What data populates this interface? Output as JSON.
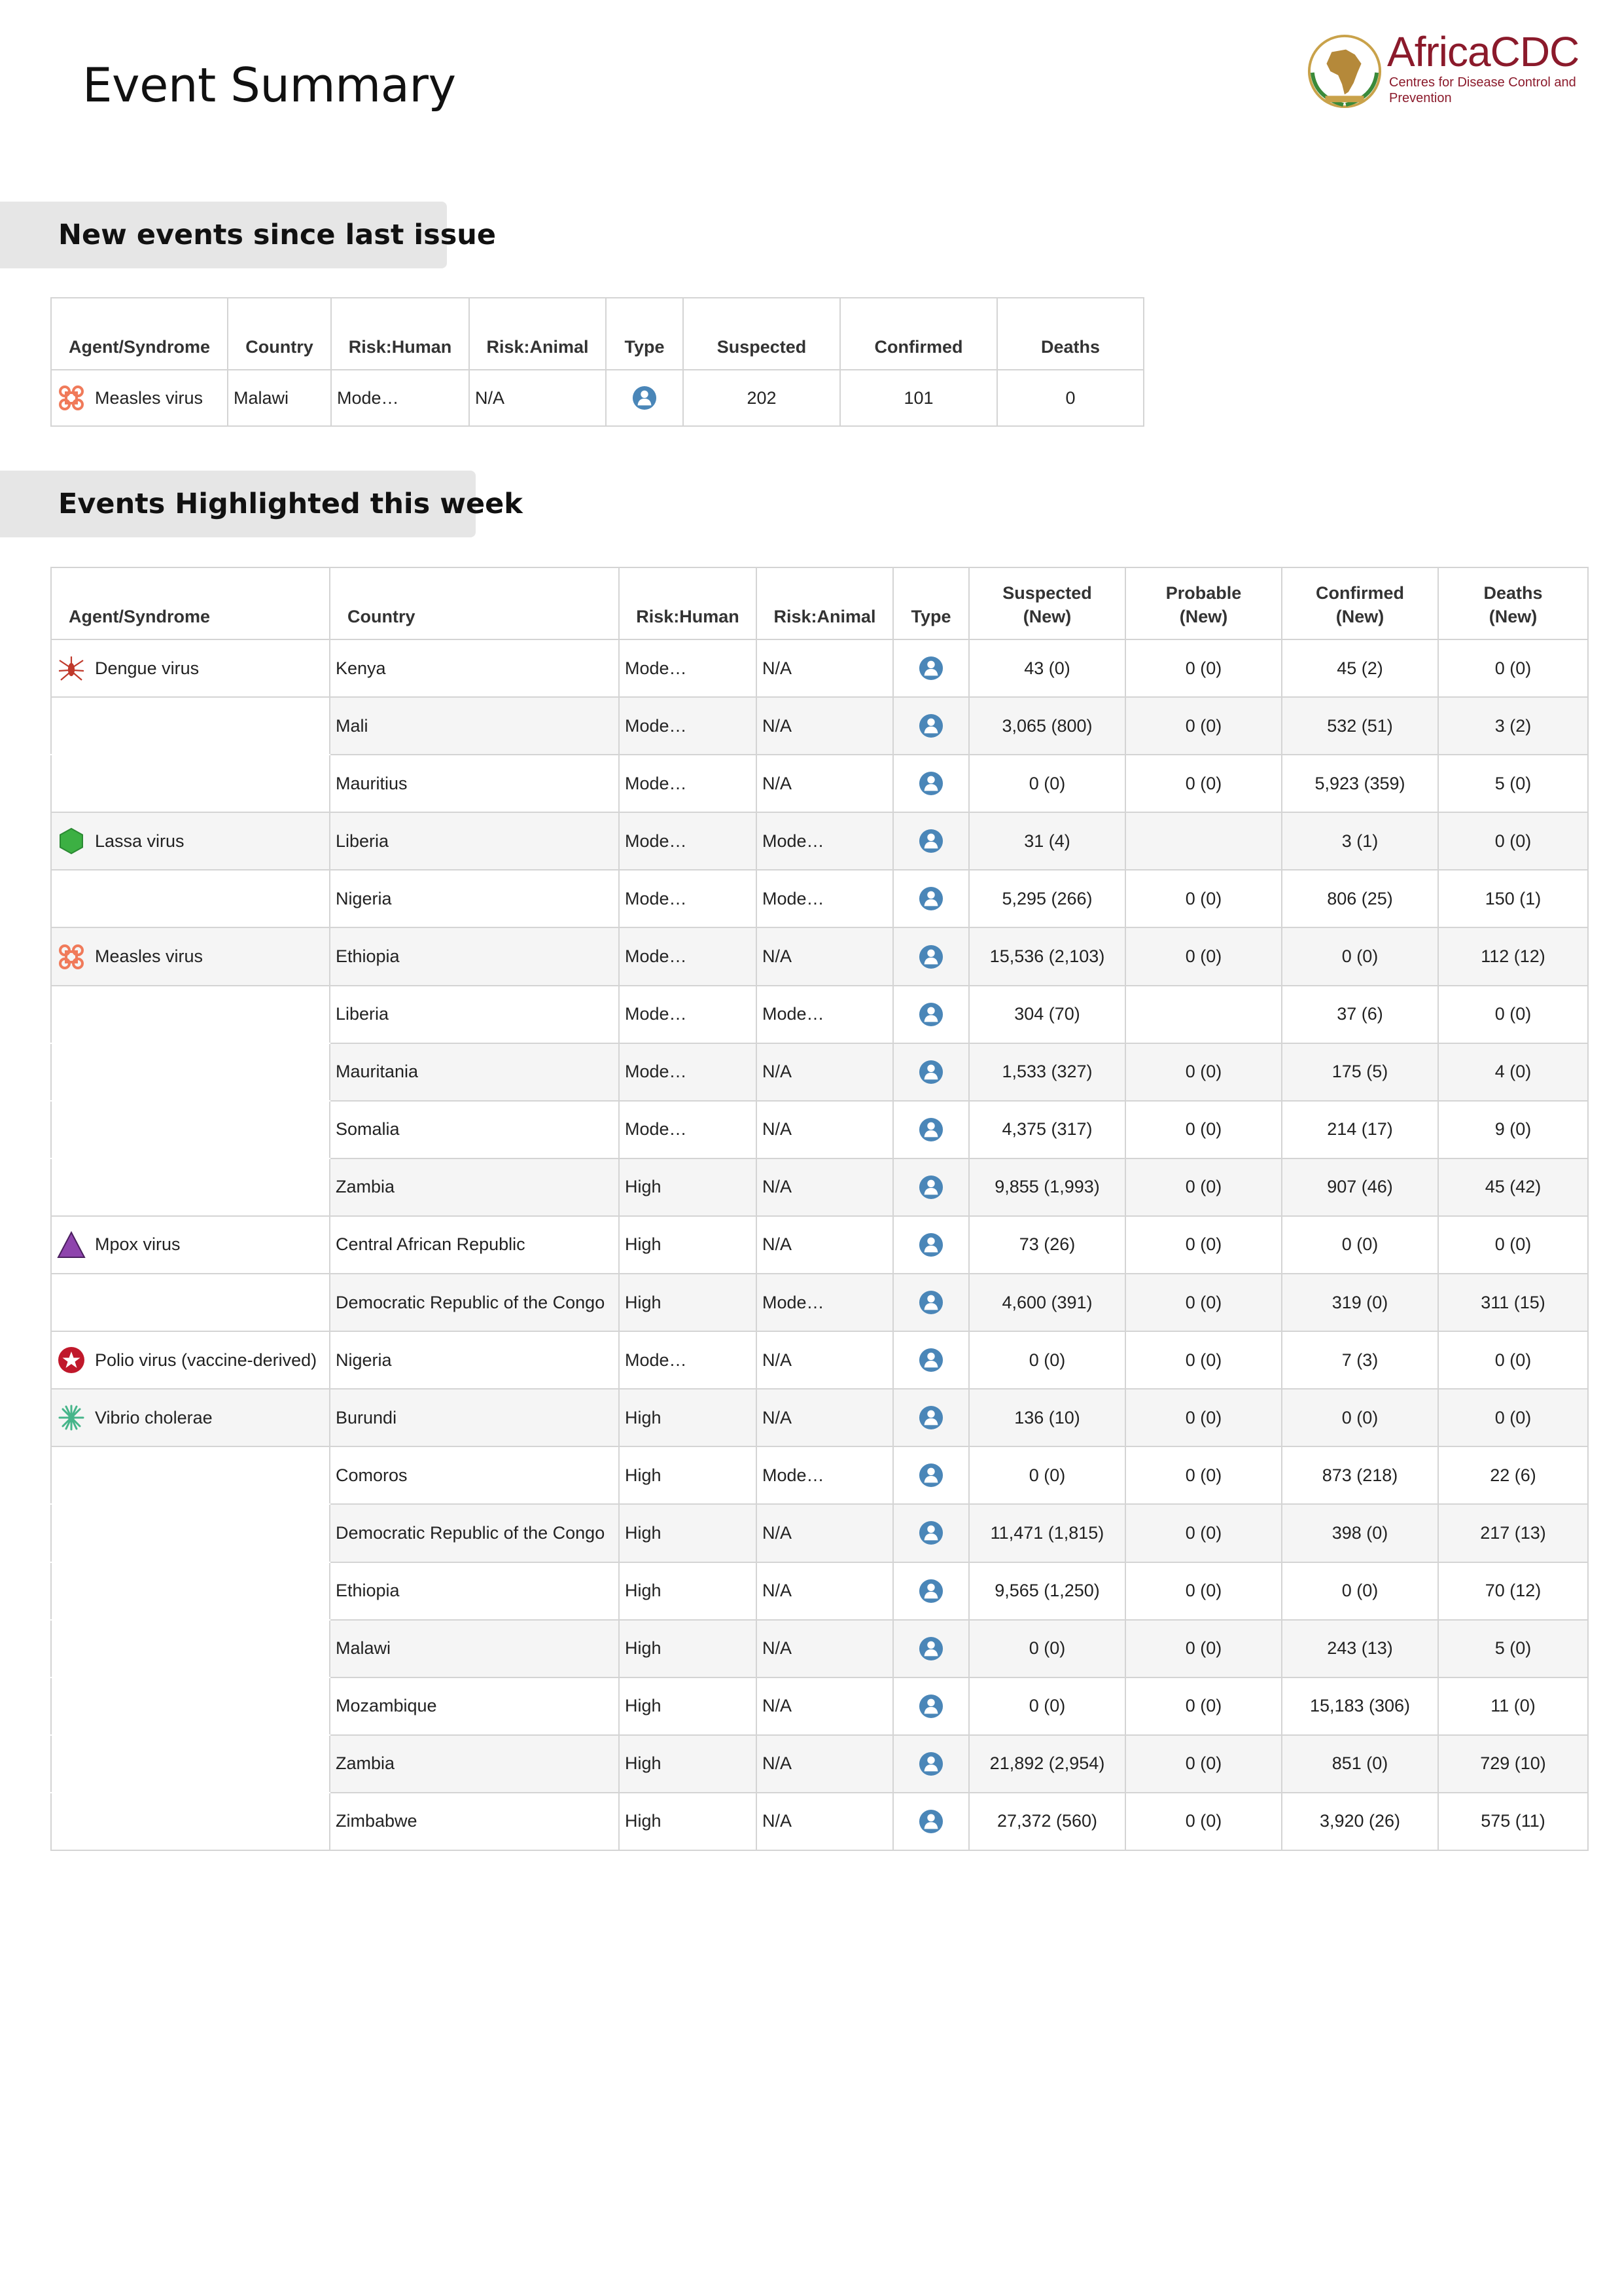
{
  "page": {
    "title": "Event Summary"
  },
  "logo": {
    "name": "AfricaCDC",
    "subtitle": "Centres for Disease Control and Prevention",
    "brand_color": "#8b1a2b"
  },
  "new_events": {
    "heading": "New events since last issue",
    "headers": {
      "agent": "Agent/Syndrome",
      "country": "Country",
      "risk_human": "Risk:Human",
      "risk_animal": "Risk:Animal",
      "type": "Type",
      "suspected": "Suspected",
      "confirmed": "Confirmed",
      "deaths": "Deaths"
    },
    "rows": [
      {
        "agent": "Measles virus",
        "agent_icon": "measles-icon",
        "country": "Malawi",
        "risk_human": "Mode…",
        "risk_animal": "N/A",
        "type_icon": "human-icon",
        "suspected": "202",
        "confirmed": "101",
        "deaths": "0"
      }
    ]
  },
  "highlighted": {
    "heading": "Events Highlighted this week",
    "headers": {
      "agent": "Agent/Syndrome",
      "country": "Country",
      "risk_human": "Risk:Human",
      "risk_animal": "Risk:Animal",
      "type": "Type",
      "suspected": "Suspected",
      "suspected_sub": "(New)",
      "probable": "Probable",
      "probable_sub": "(New)",
      "confirmed": "Confirmed",
      "confirmed_sub": "(New)",
      "deaths": "Deaths",
      "deaths_sub": "(New)"
    },
    "rows": [
      {
        "agent": "Dengue virus",
        "agent_icon": "dengue-icon",
        "country": "Kenya",
        "risk_human": "Mode…",
        "risk_animal": "N/A",
        "type_icon": "human-icon",
        "suspected": "43 (0)",
        "probable": "0 (0)",
        "confirmed": "45 (2)",
        "deaths": "0 (0)"
      },
      {
        "agent": "",
        "country": "Mali",
        "risk_human": "Mode…",
        "risk_animal": "N/A",
        "type_icon": "human-icon",
        "suspected": "3,065 (800)",
        "probable": "0 (0)",
        "confirmed": "532 (51)",
        "deaths": "3 (2)"
      },
      {
        "agent": "",
        "country": "Mauritius",
        "risk_human": "Mode…",
        "risk_animal": "N/A",
        "type_icon": "human-icon",
        "suspected": "0 (0)",
        "probable": "0 (0)",
        "confirmed": "5,923 (359)",
        "deaths": "5 (0)"
      },
      {
        "agent": "Lassa virus",
        "agent_icon": "lassa-icon",
        "country": "Liberia",
        "risk_human": "Mode…",
        "risk_animal": "Mode…",
        "type_icon": "human-icon",
        "suspected": "31 (4)",
        "probable": "",
        "confirmed": "3 (1)",
        "deaths": "0 (0)"
      },
      {
        "agent": "",
        "country": "Nigeria",
        "risk_human": "Mode…",
        "risk_animal": "Mode…",
        "type_icon": "human-icon",
        "suspected": "5,295 (266)",
        "probable": "0 (0)",
        "confirmed": "806 (25)",
        "deaths": "150 (1)"
      },
      {
        "agent": "Measles virus",
        "agent_icon": "measles-icon",
        "country": "Ethiopia",
        "risk_human": "Mode…",
        "risk_animal": "N/A",
        "type_icon": "human-icon",
        "suspected": "15,536 (2,103)",
        "probable": "0 (0)",
        "confirmed": "0 (0)",
        "deaths": "112 (12)"
      },
      {
        "agent": "",
        "country": "Liberia",
        "risk_human": "Mode…",
        "risk_animal": "Mode…",
        "type_icon": "human-icon",
        "suspected": "304 (70)",
        "probable": "",
        "confirmed": "37 (6)",
        "deaths": "0 (0)"
      },
      {
        "agent": "",
        "country": "Mauritania",
        "risk_human": "Mode…",
        "risk_animal": "N/A",
        "type_icon": "human-icon",
        "suspected": "1,533 (327)",
        "probable": "0 (0)",
        "confirmed": "175 (5)",
        "deaths": "4 (0)"
      },
      {
        "agent": "",
        "country": "Somalia",
        "risk_human": "Mode…",
        "risk_animal": "N/A",
        "type_icon": "human-icon",
        "suspected": "4,375 (317)",
        "probable": "0 (0)",
        "confirmed": "214 (17)",
        "deaths": "9 (0)"
      },
      {
        "agent": "",
        "country": "Zambia",
        "risk_human": "High",
        "risk_animal": "N/A",
        "type_icon": "human-icon",
        "suspected": "9,855 (1,993)",
        "probable": "0 (0)",
        "confirmed": "907 (46)",
        "deaths": "45 (42)"
      },
      {
        "agent": "Mpox virus",
        "agent_icon": "mpox-icon",
        "country": "Central African Republic",
        "risk_human": "High",
        "risk_animal": "N/A",
        "type_icon": "human-icon",
        "suspected": "73 (26)",
        "probable": "0 (0)",
        "confirmed": "0 (0)",
        "deaths": "0 (0)"
      },
      {
        "agent": "",
        "country": "Democratic Republic of the Congo",
        "risk_human": "High",
        "risk_animal": "Mode…",
        "type_icon": "human-icon",
        "suspected": "4,600 (391)",
        "probable": "0 (0)",
        "confirmed": "319 (0)",
        "deaths": "311 (15)"
      },
      {
        "agent": "Polio virus (vaccine-derived)",
        "agent_icon": "polio-icon",
        "country": "Nigeria",
        "risk_human": "Mode…",
        "risk_animal": "N/A",
        "type_icon": "human-icon",
        "suspected": "0 (0)",
        "probable": "0 (0)",
        "confirmed": "7 (3)",
        "deaths": "0 (0)"
      },
      {
        "agent": "Vibrio cholerae",
        "agent_icon": "cholera-icon",
        "country": "Burundi",
        "risk_human": "High",
        "risk_animal": "N/A",
        "type_icon": "human-icon",
        "suspected": "136 (10)",
        "probable": "0 (0)",
        "confirmed": "0 (0)",
        "deaths": "0 (0)"
      },
      {
        "agent": "",
        "country": "Comoros",
        "risk_human": "High",
        "risk_animal": "Mode…",
        "type_icon": "human-icon",
        "suspected": "0 (0)",
        "probable": "0 (0)",
        "confirmed": "873 (218)",
        "deaths": "22 (6)"
      },
      {
        "agent": "",
        "country": "Democratic Republic of the Congo",
        "risk_human": "High",
        "risk_animal": "N/A",
        "type_icon": "human-icon",
        "suspected": "11,471 (1,815)",
        "probable": "0 (0)",
        "confirmed": "398 (0)",
        "deaths": "217 (13)"
      },
      {
        "agent": "",
        "country": "Ethiopia",
        "risk_human": "High",
        "risk_animal": "N/A",
        "type_icon": "human-icon",
        "suspected": "9,565 (1,250)",
        "probable": "0 (0)",
        "confirmed": "0 (0)",
        "deaths": "70 (12)"
      },
      {
        "agent": "",
        "country": "Malawi",
        "risk_human": "High",
        "risk_animal": "N/A",
        "type_icon": "human-icon",
        "suspected": "0 (0)",
        "probable": "0 (0)",
        "confirmed": "243 (13)",
        "deaths": "5 (0)"
      },
      {
        "agent": "",
        "country": "Mozambique",
        "risk_human": "High",
        "risk_animal": "N/A",
        "type_icon": "human-icon",
        "suspected": "0 (0)",
        "probable": "0 (0)",
        "confirmed": "15,183 (306)",
        "deaths": "11 (0)"
      },
      {
        "agent": "",
        "country": "Zambia",
        "risk_human": "High",
        "risk_animal": "N/A",
        "type_icon": "human-icon",
        "suspected": "21,892 (2,954)",
        "probable": "0 (0)",
        "confirmed": "851 (0)",
        "deaths": "729 (10)"
      },
      {
        "agent": "",
        "country": "Zimbabwe",
        "risk_human": "High",
        "risk_animal": "N/A",
        "type_icon": "human-icon",
        "suspected": "27,372 (560)",
        "probable": "0 (0)",
        "confirmed": "3,920 (26)",
        "deaths": "575 (11)"
      }
    ]
  },
  "colors": {
    "type_icon": "#4a86b8",
    "measles": "#f07a5a",
    "dengue": "#c0392b",
    "lassa": "#3cb043",
    "mpox": "#8e44ad",
    "polio": "#c0182b",
    "cholera": "#46b58a"
  }
}
